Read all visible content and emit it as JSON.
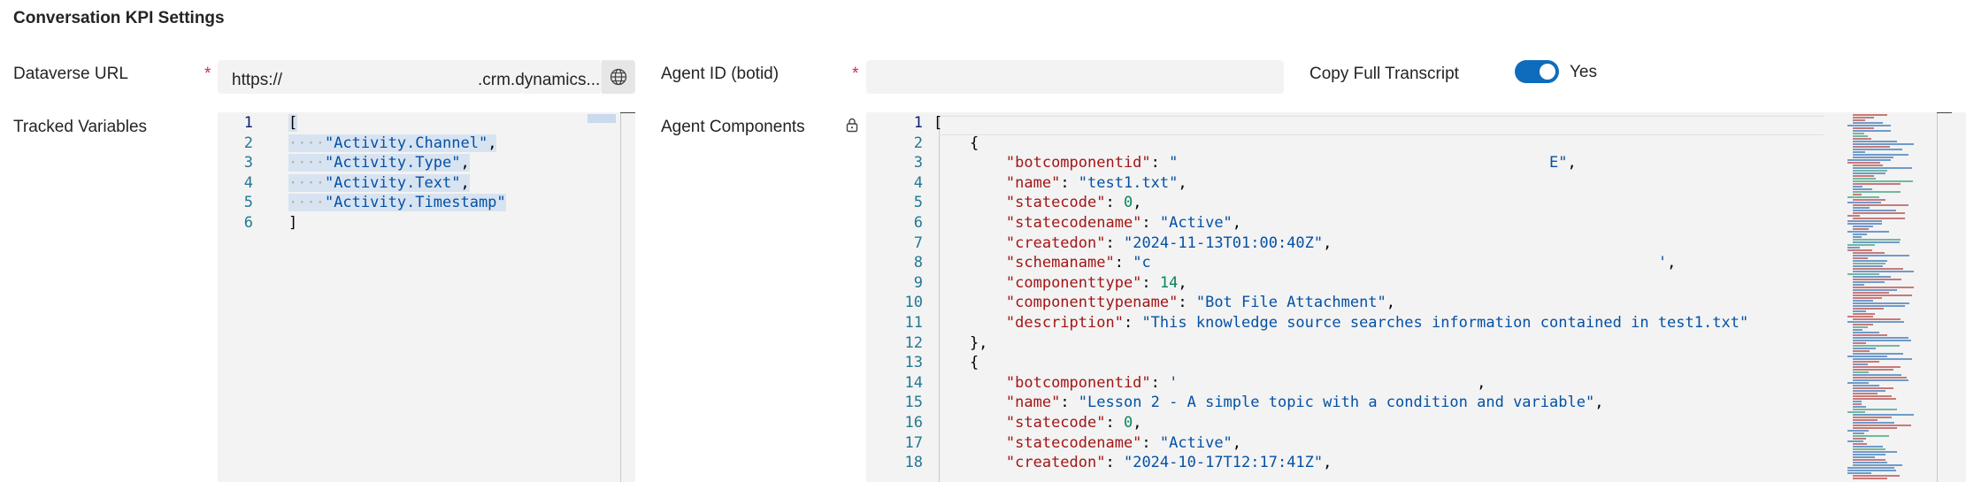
{
  "section": {
    "title": "Conversation KPI Settings"
  },
  "dataverse": {
    "label": "Dataverse URL",
    "required_mark": "*",
    "value_prefix": "https://",
    "value_suffix": ".crm.dynamics...",
    "icon": "globe-icon"
  },
  "agent_id": {
    "label": "Agent ID (botid)",
    "required_mark": "*",
    "value": ""
  },
  "copy_transcript": {
    "label": "Copy Full Transcript",
    "toggle_on": true,
    "toggle_text": "Yes",
    "accent": "#0f6cbd"
  },
  "tracked_variables": {
    "label": "Tracked Variables",
    "line_numbers": [
      "1",
      "2",
      "3",
      "4",
      "5",
      "6"
    ],
    "lines": [
      [
        {
          "t": "p",
          "v": "["
        }
      ],
      [
        {
          "t": "d",
          "v": "····"
        },
        {
          "t": "s",
          "v": "\"Activity.Channel\""
        },
        {
          "t": "p",
          "v": ","
        }
      ],
      [
        {
          "t": "d",
          "v": "····"
        },
        {
          "t": "s",
          "v": "\"Activity.Type\""
        },
        {
          "t": "p",
          "v": ","
        }
      ],
      [
        {
          "t": "d",
          "v": "····"
        },
        {
          "t": "s",
          "v": "\"Activity.Text\""
        },
        {
          "t": "p",
          "v": ","
        }
      ],
      [
        {
          "t": "d",
          "v": "····"
        },
        {
          "t": "s",
          "v": "\"Activity.Timestamp\""
        }
      ],
      [
        {
          "t": "p",
          "v": "]"
        }
      ]
    ]
  },
  "agent_components": {
    "label": "Agent Components",
    "lock_icon": "lock-icon",
    "line_numbers": [
      "1",
      "2",
      "3",
      "4",
      "5",
      "6",
      "7",
      "8",
      "9",
      "10",
      "11",
      "12",
      "13",
      "14",
      "15",
      "16",
      "17",
      "18"
    ],
    "lines": [
      [
        {
          "t": "p",
          "v": "["
        }
      ],
      [
        {
          "t": "p",
          "v": "    {"
        }
      ],
      [
        {
          "t": "p",
          "v": "        "
        },
        {
          "t": "k",
          "v": "\"botcomponentid\""
        },
        {
          "t": "p",
          "v": ": "
        },
        {
          "t": "s",
          "v": "\""
        },
        {
          "t": "p",
          "v": "                                         "
        },
        {
          "t": "s",
          "v": "E\""
        },
        {
          "t": "p",
          "v": ","
        }
      ],
      [
        {
          "t": "p",
          "v": "        "
        },
        {
          "t": "k",
          "v": "\"name\""
        },
        {
          "t": "p",
          "v": ": "
        },
        {
          "t": "s",
          "v": "\"test1.txt\""
        },
        {
          "t": "p",
          "v": ","
        }
      ],
      [
        {
          "t": "p",
          "v": "        "
        },
        {
          "t": "k",
          "v": "\"statecode\""
        },
        {
          "t": "p",
          "v": ": "
        },
        {
          "t": "n",
          "v": "0"
        },
        {
          "t": "p",
          "v": ","
        }
      ],
      [
        {
          "t": "p",
          "v": "        "
        },
        {
          "t": "k",
          "v": "\"statecodename\""
        },
        {
          "t": "p",
          "v": ": "
        },
        {
          "t": "s",
          "v": "\"Active\""
        },
        {
          "t": "p",
          "v": ","
        }
      ],
      [
        {
          "t": "p",
          "v": "        "
        },
        {
          "t": "k",
          "v": "\"createdon\""
        },
        {
          "t": "p",
          "v": ": "
        },
        {
          "t": "s",
          "v": "\"2024-11-13T01:00:40Z\""
        },
        {
          "t": "p",
          "v": ","
        }
      ],
      [
        {
          "t": "p",
          "v": "        "
        },
        {
          "t": "k",
          "v": "\"schemaname\""
        },
        {
          "t": "p",
          "v": ": "
        },
        {
          "t": "s",
          "v": "\"c"
        },
        {
          "t": "p",
          "v": "                                                        "
        },
        {
          "t": "s",
          "v": "'"
        },
        {
          "t": "p",
          "v": ","
        }
      ],
      [
        {
          "t": "p",
          "v": "        "
        },
        {
          "t": "k",
          "v": "\"componenttype\""
        },
        {
          "t": "p",
          "v": ": "
        },
        {
          "t": "n",
          "v": "14"
        },
        {
          "t": "p",
          "v": ","
        }
      ],
      [
        {
          "t": "p",
          "v": "        "
        },
        {
          "t": "k",
          "v": "\"componenttypename\""
        },
        {
          "t": "p",
          "v": ": "
        },
        {
          "t": "s",
          "v": "\"Bot File Attachment\""
        },
        {
          "t": "p",
          "v": ","
        }
      ],
      [
        {
          "t": "p",
          "v": "        "
        },
        {
          "t": "k",
          "v": "\"description\""
        },
        {
          "t": "p",
          "v": ": "
        },
        {
          "t": "s",
          "v": "\"This knowledge source searches information contained in test1.txt\""
        }
      ],
      [
        {
          "t": "p",
          "v": "    },"
        }
      ],
      [
        {
          "t": "p",
          "v": "    {"
        }
      ],
      [
        {
          "t": "p",
          "v": "        "
        },
        {
          "t": "k",
          "v": "\"botcomponentid\""
        },
        {
          "t": "p",
          "v": ": "
        },
        {
          "t": "s",
          "v": "'"
        },
        {
          "t": "p",
          "v": "                                 ,"
        }
      ],
      [
        {
          "t": "p",
          "v": "        "
        },
        {
          "t": "k",
          "v": "\"name\""
        },
        {
          "t": "p",
          "v": ": "
        },
        {
          "t": "s",
          "v": "\"Lesson 2 - A simple topic with a condition and variable\""
        },
        {
          "t": "p",
          "v": ","
        }
      ],
      [
        {
          "t": "p",
          "v": "        "
        },
        {
          "t": "k",
          "v": "\"statecode\""
        },
        {
          "t": "p",
          "v": ": "
        },
        {
          "t": "n",
          "v": "0"
        },
        {
          "t": "p",
          "v": ","
        }
      ],
      [
        {
          "t": "p",
          "v": "        "
        },
        {
          "t": "k",
          "v": "\"statecodename\""
        },
        {
          "t": "p",
          "v": ": "
        },
        {
          "t": "s",
          "v": "\"Active\""
        },
        {
          "t": "p",
          "v": ","
        }
      ],
      [
        {
          "t": "p",
          "v": "        "
        },
        {
          "t": "k",
          "v": "\"createdon\""
        },
        {
          "t": "p",
          "v": ": "
        },
        {
          "t": "s",
          "v": "\"2024-10-17T12:17:41Z\""
        },
        {
          "t": "p",
          "v": ","
        }
      ]
    ]
  }
}
